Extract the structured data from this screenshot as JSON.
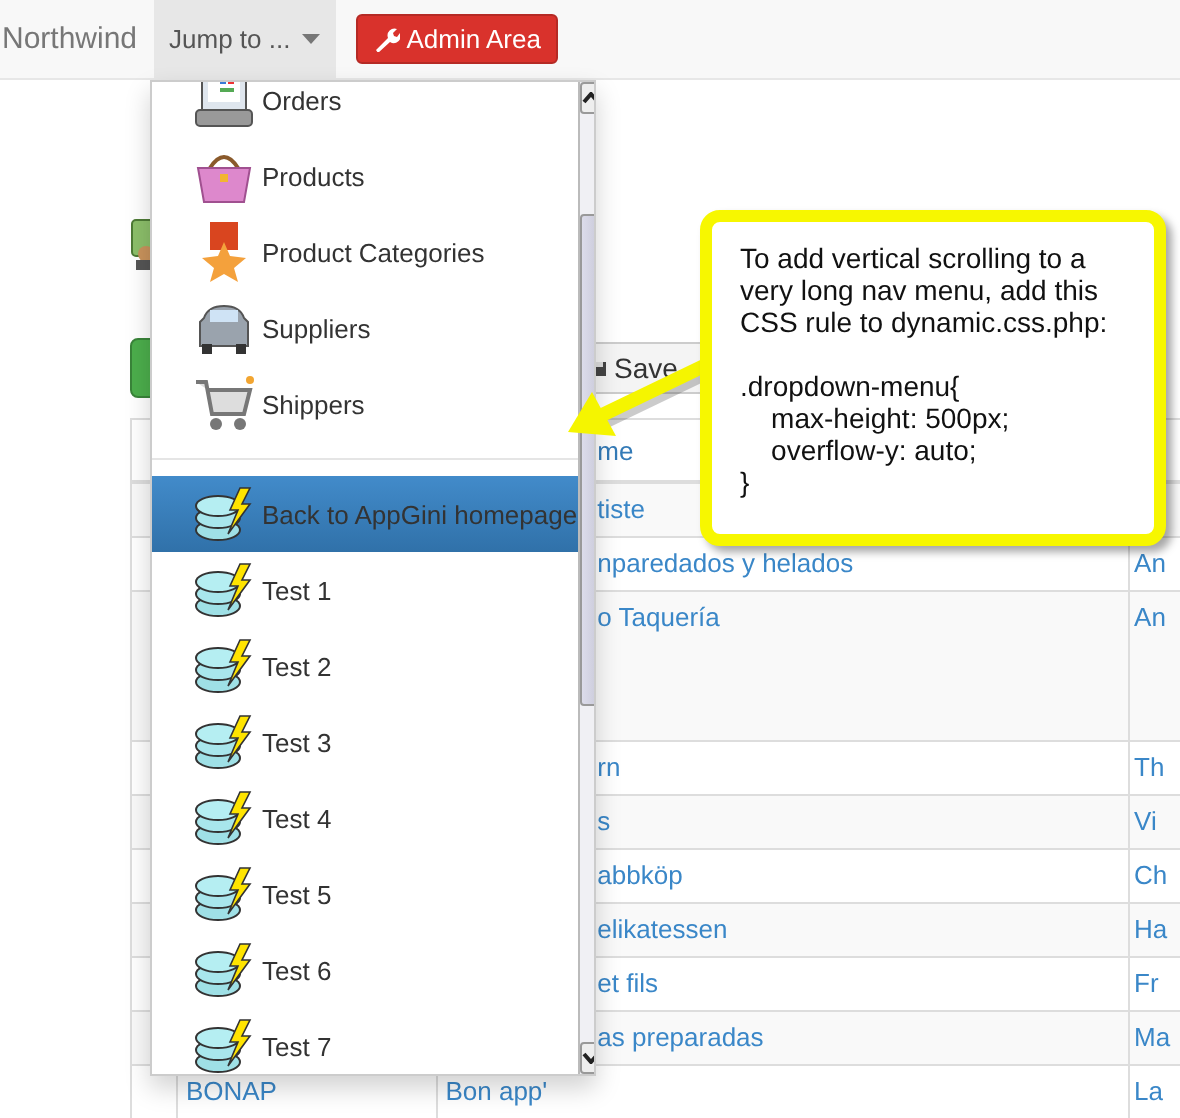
{
  "navbar": {
    "brand": "Northwind",
    "jump_menu": {
      "label": "Jump to ...",
      "expanded": true
    },
    "admin_button": "Admin Area"
  },
  "toolbar": {
    "save_button": "Save"
  },
  "table": {
    "columns": [
      "me"
    ],
    "rows": [
      {
        "column_3": "tiste",
        "tall": false
      },
      {
        "column_3": "nparedados y helados",
        "column_4": "An",
        "tall": false
      },
      {
        "column_3": "o Taquería",
        "column_4": "An",
        "tall": true
      },
      {
        "column_3": "rn",
        "column_4": "Th",
        "tall": false
      },
      {
        "column_3": "s",
        "column_4": "Vi",
        "tall": false
      },
      {
        "column_3": "abbköp",
        "column_4": "Ch",
        "tall": false
      },
      {
        "column_3": "elikatessen",
        "column_4": "Ha",
        "tall": false
      },
      {
        "column_3": "et fils",
        "column_4": "Fr",
        "tall": false
      },
      {
        "column_3": "as preparadas",
        "column_4": "Ma",
        "tall": false
      },
      {
        "column_2": "BONAP",
        "column_3": "Bon app'",
        "column_4": "La",
        "tall": false
      }
    ]
  },
  "dropdown_menu": {
    "tables": [
      {
        "label": "Orders"
      },
      {
        "label": "Products"
      },
      {
        "label": "Product Categories"
      },
      {
        "label": "Suppliers"
      },
      {
        "label": "Shippers"
      }
    ],
    "links": [
      {
        "label": "Back to AppGini homepage",
        "selected": true
      },
      {
        "label": "Test 1",
        "selected": false
      },
      {
        "label": "Test 2",
        "selected": false
      },
      {
        "label": "Test 3",
        "selected": false
      },
      {
        "label": "Test 4",
        "selected": false
      },
      {
        "label": "Test 5",
        "selected": false
      },
      {
        "label": "Test 6",
        "selected": false
      },
      {
        "label": "Test 7",
        "selected": false
      }
    ]
  },
  "callout": {
    "text": "To add vertical scrolling to a very long nav menu, add this CSS rule to dynamic.css.php:",
    "code": ".dropdown-menu{\n    max-height: 500px;\n    overflow-y: auto;\n}"
  }
}
